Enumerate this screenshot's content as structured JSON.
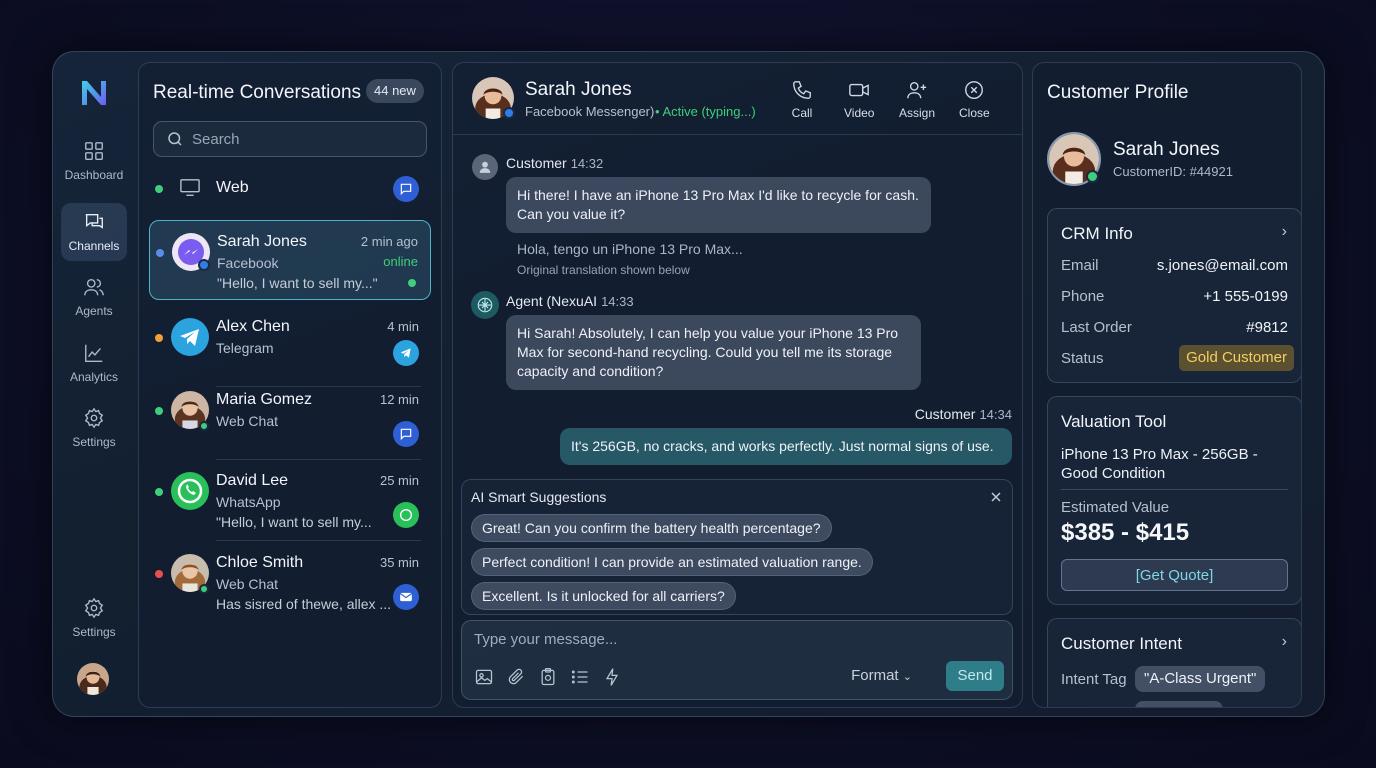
{
  "nav": {
    "items": [
      {
        "label": "Dashboard",
        "icon": "grid-icon"
      },
      {
        "label": "Channels",
        "icon": "chat-bubbles-icon",
        "active": true
      },
      {
        "label": "Agents",
        "icon": "users-icon"
      },
      {
        "label": "Analytics",
        "icon": "line-chart-icon"
      },
      {
        "label": "Settings",
        "icon": "gear-icon"
      }
    ],
    "bottom_settings": "Settings"
  },
  "conversations": {
    "title": "Real-time Conversations",
    "new_badge": "44 new",
    "search_placeholder": "Search",
    "web_label": "Web",
    "items": [
      {
        "name": "Sarah Jones",
        "channel": "Facebook",
        "time": "2 min ago",
        "status": "online",
        "preview": "\"Hello, I want to sell my...\""
      },
      {
        "name": "Alex Chen",
        "channel": "Telegram",
        "time": "4 min",
        "preview": ""
      },
      {
        "name": "Maria Gomez",
        "channel": "Web Chat",
        "time": "12 min",
        "preview": ""
      },
      {
        "name": "David Lee",
        "channel": "WhatsApp",
        "time": "25 min",
        "preview": "\"Hello, I want to sell my..."
      },
      {
        "name": "Chloe Smith",
        "channel": "Web Chat",
        "time": "35 min",
        "preview": "Has sisred of thewe, allex ..."
      }
    ]
  },
  "chat": {
    "contact_name": "Sarah Jones",
    "contact_channel": "Facebook Messenger)",
    "contact_status": "• Active (typing...)",
    "actions": {
      "call": "Call",
      "video": "Video",
      "assign": "Assign",
      "close": "Close"
    },
    "messages": [
      {
        "sender": "Customer",
        "time": "14:32",
        "text": "Hi there! I have an iPhone 13 Pro Max I'd like to recycle for cash. Can you value it?"
      },
      {
        "original": "Hola, tengo un iPhone 13 Pro Max...",
        "note": "Original translation shown below"
      },
      {
        "sender": "Agent (NexuAI",
        "time": "14:33",
        "text": "Hi Sarah! Absolutely, I can help you value your iPhone 13 Pro Max for second-hand recycling. Could you tell me its storage capacity and condition?"
      },
      {
        "sender": "Customer",
        "time": "14:34",
        "text": "It's 256GB, no cracks, and works perfectly. Just normal signs of use."
      }
    ],
    "suggestions_title": "AI Smart Suggestions",
    "suggestions": [
      "Great! Can you confirm the battery health percentage?",
      "Perfect condition! I can provide an estimated valuation range.",
      "Excellent. Is it unlocked for all carriers?"
    ],
    "composer_placeholder": "Type your message...",
    "format_label": "Format",
    "send_label": "Send"
  },
  "profile": {
    "title": "Customer Profile",
    "name": "Sarah Jones",
    "customer_id": "CustomerID: #44921",
    "crm": {
      "title": "CRM Info",
      "email_label": "Email",
      "email": "s.jones@email.com",
      "phone_label": "Phone",
      "phone": "+1 555-0199",
      "order_label": "Last Order",
      "order": "#9812",
      "status_label": "Status",
      "status": "Gold Customer"
    },
    "valuation": {
      "title": "Valuation Tool",
      "device": "iPhone 13 Pro Max - 256GB - Good Condition",
      "estimated_label": "Estimated Value",
      "estimated_value": "$385 - $415",
      "quote_button": "[Get Quote]"
    },
    "intent": {
      "title": "Customer Intent",
      "tag_label": "Intent Tag",
      "tag": "\"A-Class Urgent\""
    }
  },
  "colors": {
    "accent": "#4fb4c6",
    "online": "#3ecf7a",
    "gold": "#f4cf63",
    "send": "#2f7d88"
  }
}
